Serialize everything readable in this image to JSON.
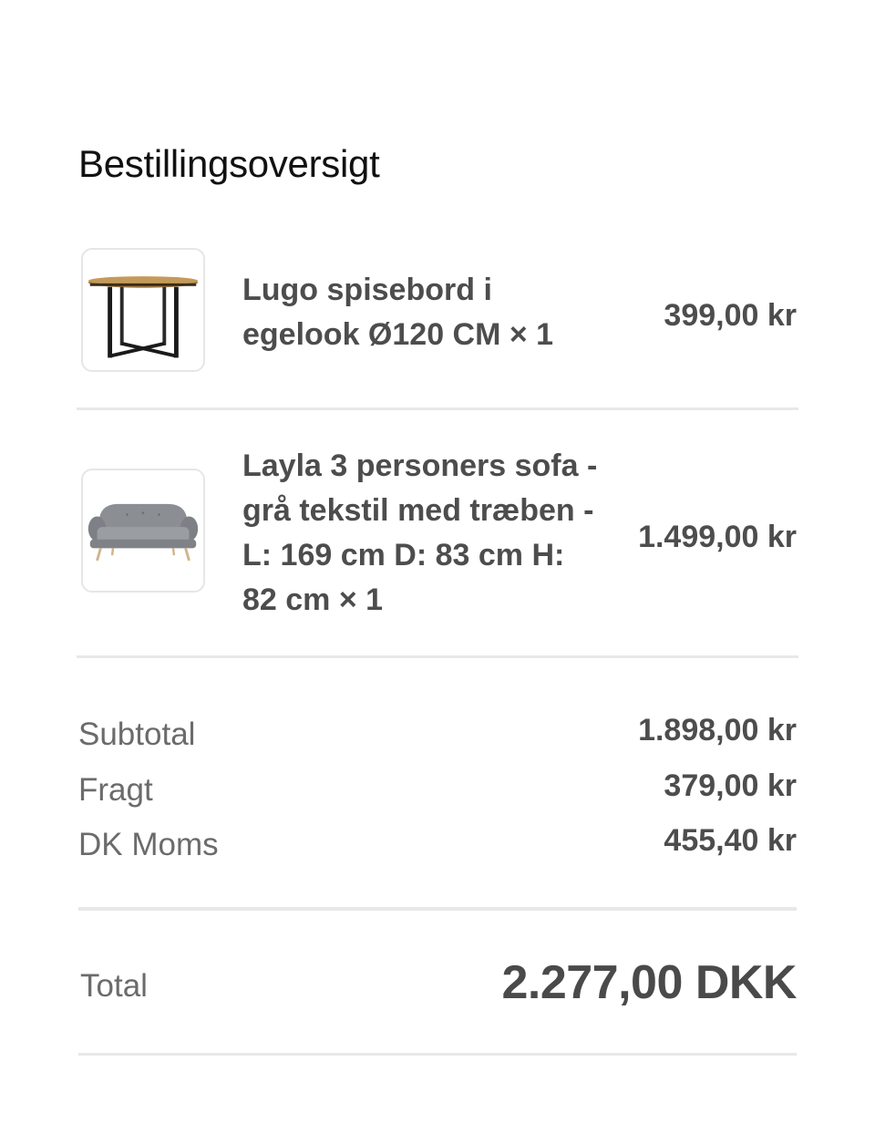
{
  "summary": {
    "title": "Bestillingsoversigt"
  },
  "items": [
    {
      "name": "Lugo spisebord i egelook Ø120 CM × 1",
      "price": "399,00 kr",
      "image": "dining-table-image"
    },
    {
      "name": "Layla 3 personers sofa - grå tekstil med træben - L: 169 cm D: 83 cm H: 82 cm × 1",
      "price": "1.499,00 kr",
      "image": "sofa-image"
    }
  ],
  "totals": {
    "subtotal_label": "Subtotal",
    "subtotal_value": "1.898,00 kr",
    "shipping_label": "Fragt",
    "shipping_value": "379,00 kr",
    "vat_label": "DK Moms",
    "vat_value": "455,40 kr",
    "total_label": "Total",
    "total_value": "2.277,00 DKK"
  },
  "colors": {
    "text_dark": "#111111",
    "text_body": "#4d4d4d",
    "text_muted": "#6b6b6b",
    "divider": "#e8e8e8"
  }
}
